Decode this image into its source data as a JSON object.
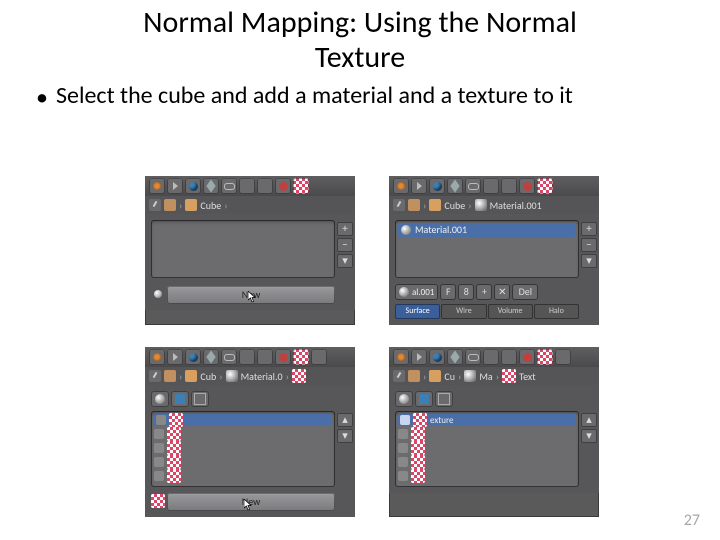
{
  "title_line1": "Normal Mapping: Using the Normal",
  "title_line2": "Texture",
  "bullet1": "Select the cube and add a material and a texture to it",
  "page_number": "27",
  "panel_a": {
    "crumb_obj": "Cube",
    "new_label": "New"
  },
  "panel_b": {
    "crumb_obj": "Cube",
    "crumb_mat": "Material.001",
    "mat_name": "Material.001",
    "id_text": "al.001",
    "id_F": "F",
    "id_users": "8",
    "id_plus": "+",
    "id_x": "✕",
    "del_label": "Del",
    "mode_surface": "Surface",
    "mode_wire": "Wire",
    "mode_volume": "Volume",
    "mode_halo": "Halo"
  },
  "panel_c": {
    "crumb_obj": "Cub",
    "crumb_mat": "Material.0",
    "new_label": "New"
  },
  "panel_d": {
    "crumb_obj": "Cu",
    "crumb_mat": "Ma",
    "crumb_tex": "Text",
    "tex_name": "exture"
  }
}
